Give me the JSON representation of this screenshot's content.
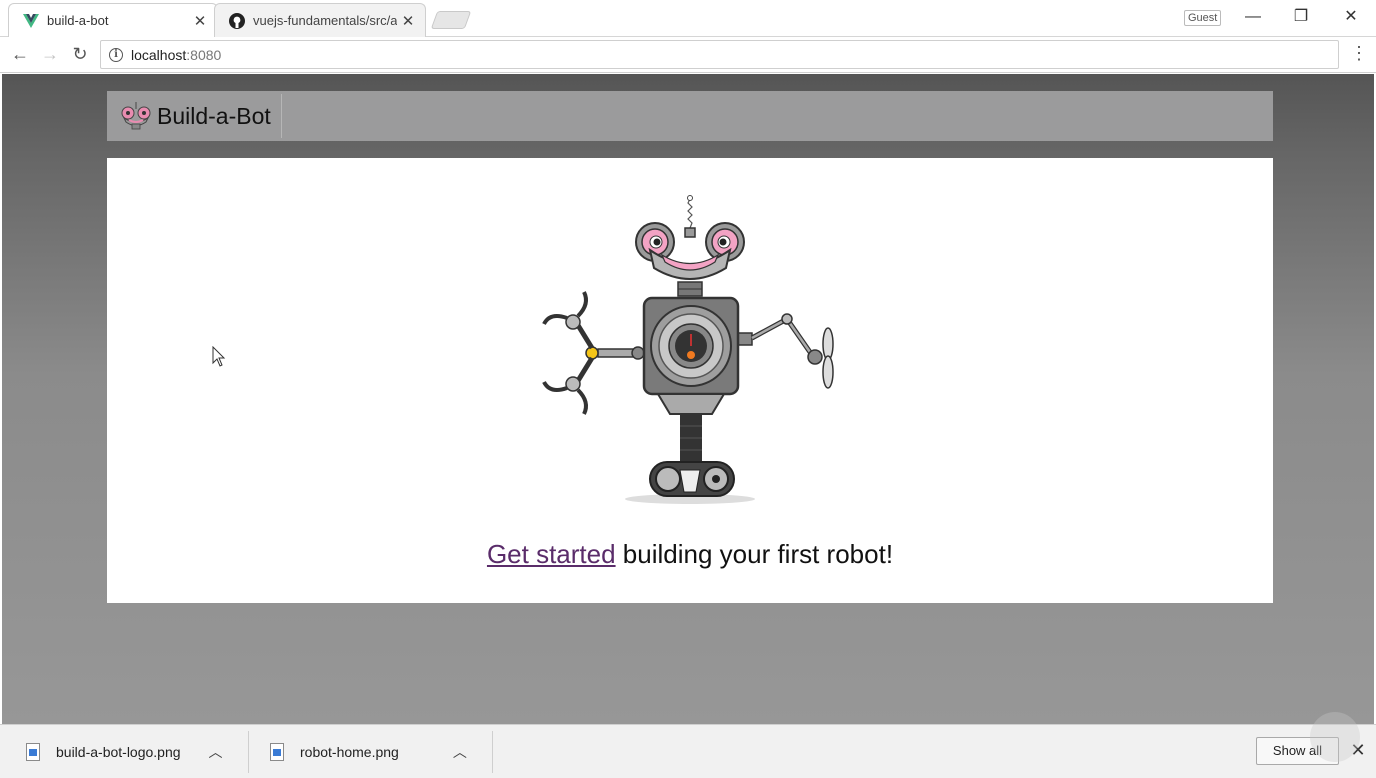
{
  "browser": {
    "tabs": [
      {
        "title": "build-a-bot",
        "favicon": "vue-icon",
        "active": true
      },
      {
        "title": "vuejs-fundamentals/src/a",
        "favicon": "github-icon",
        "active": false
      }
    ],
    "profile_label": "Guest",
    "address": {
      "host": "localhost",
      "port": ":8080"
    }
  },
  "page": {
    "brand_name": "Build-a-Bot",
    "tagline_link": "Get started",
    "tagline_rest": " building your first robot!"
  },
  "downloads": {
    "items": [
      {
        "filename": "build-a-bot-logo.png"
      },
      {
        "filename": "robot-home.png"
      }
    ],
    "show_all_label": "Show all"
  },
  "colors": {
    "link": "#5a2c6a",
    "header_bar": "#9b9b9c",
    "panel": "#ffffff"
  }
}
